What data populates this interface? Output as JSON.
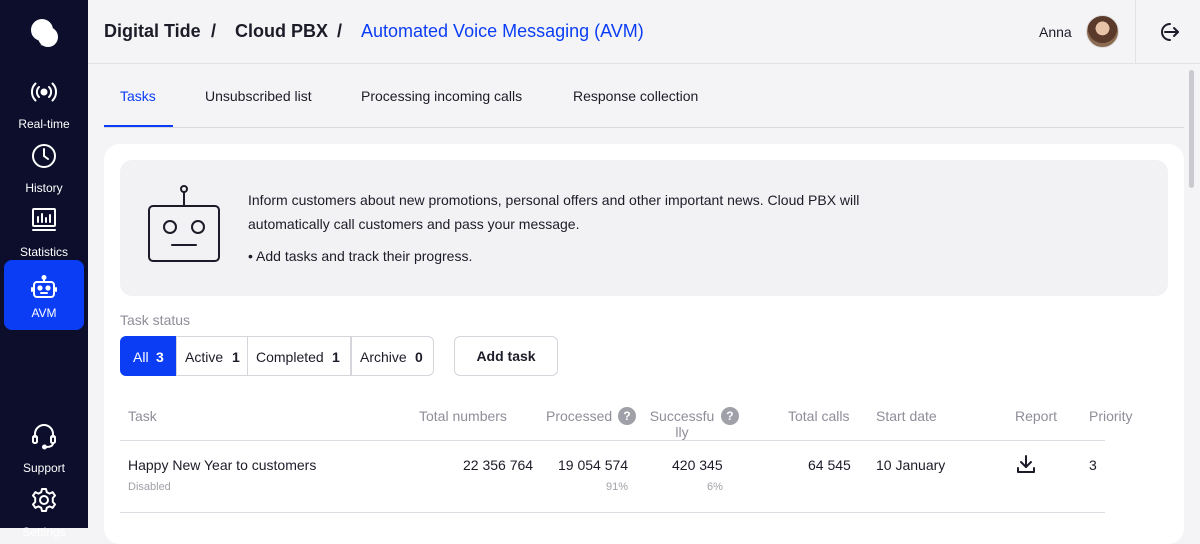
{
  "sidebar": {
    "items": [
      {
        "label": "Real-time",
        "icon": "broadcast-icon"
      },
      {
        "label": "History",
        "icon": "clock-icon"
      },
      {
        "label": "Statistics",
        "icon": "bar-chart-icon"
      },
      {
        "label": "AVM",
        "icon": "robot-icon",
        "active": true
      },
      {
        "label": "Support",
        "icon": "headset-icon"
      },
      {
        "label": "Settings",
        "icon": "gear-icon"
      }
    ]
  },
  "header": {
    "breadcrumb": [
      "Digital Tide",
      "/",
      "Cloud PBX",
      "/",
      "Automated Voice Messaging (AVM)"
    ],
    "user": "Anna"
  },
  "tabs": [
    "Tasks",
    "Unsubscribed list",
    "Processing incoming calls",
    "Response collection"
  ],
  "info": {
    "text": "Inform customers about new promotions, personal offers and other important news. Cloud PBX will automatically call customers and pass your message.",
    "bullet": "• Add tasks and track their progress."
  },
  "filters": {
    "label": "Task status",
    "options": [
      {
        "label": "All",
        "count": "3",
        "active": true
      },
      {
        "label": "Active",
        "count": "1"
      },
      {
        "label": "Completed",
        "count": "1"
      },
      {
        "label": "Archive",
        "count": "0"
      }
    ],
    "add_task": "Add task"
  },
  "table": {
    "columns": [
      "Task",
      "Total numbers",
      "Processed",
      "Successfu lly",
      "Total calls",
      "Start date",
      "Report",
      "Priority"
    ],
    "help_glyph": "?",
    "rows": [
      {
        "task": "Happy New Year to customers",
        "status": "Disabled",
        "total_numbers": "22 356 764",
        "processed": "19 054 574",
        "processed_pct": "91%",
        "successfully": "420 345",
        "successfully_pct": "6%",
        "total_calls": "64 545",
        "start_date": "10 January",
        "priority": "3"
      }
    ]
  },
  "colors": {
    "accent": "#0b3df5",
    "sidebar": "#0c0e2b"
  }
}
